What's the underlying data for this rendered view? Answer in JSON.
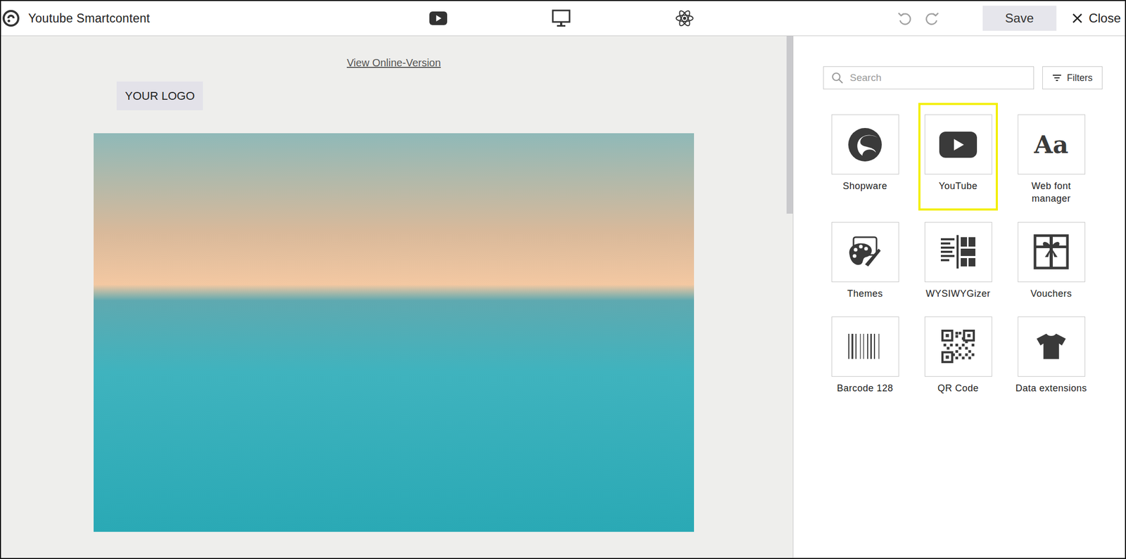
{
  "window": {
    "title": "Youtube Smartcontent"
  },
  "toolbar": {
    "views": [
      {
        "kind": "youtube"
      },
      {
        "kind": "desktop"
      },
      {
        "kind": "atom"
      }
    ],
    "history": [
      {
        "kind": "undo",
        "disabled": true
      },
      {
        "kind": "redo",
        "disabled": true
      }
    ],
    "save": {
      "label": "Save"
    },
    "close": {
      "label": "Close"
    }
  },
  "canvas": {
    "online_link": "View Online-Version",
    "logo": "YOUR LOGO"
  },
  "panel": {
    "search": {
      "placeholder": "Search"
    },
    "filters": {
      "label": "Filters"
    },
    "apps": [
      {
        "label": "Shopware",
        "kind": "shopware",
        "selected": false
      },
      {
        "label": "YouTube",
        "kind": "youtube",
        "selected": true
      },
      {
        "label": "Web font manager",
        "kind": "fonts",
        "glyph": "Aa",
        "selected": false
      },
      {
        "label": "Themes",
        "kind": "themes",
        "selected": false
      },
      {
        "label": "WYSIWYGizer",
        "kind": "wysiwyg",
        "selected": false
      },
      {
        "label": "Vouchers",
        "kind": "vouchers",
        "selected": false
      },
      {
        "label": "Barcode 128",
        "kind": "barcode",
        "selected": false
      },
      {
        "label": "QR Code",
        "kind": "qrcode",
        "selected": false
      },
      {
        "label": "Data extensions",
        "kind": "shirt",
        "selected": false
      }
    ]
  }
}
